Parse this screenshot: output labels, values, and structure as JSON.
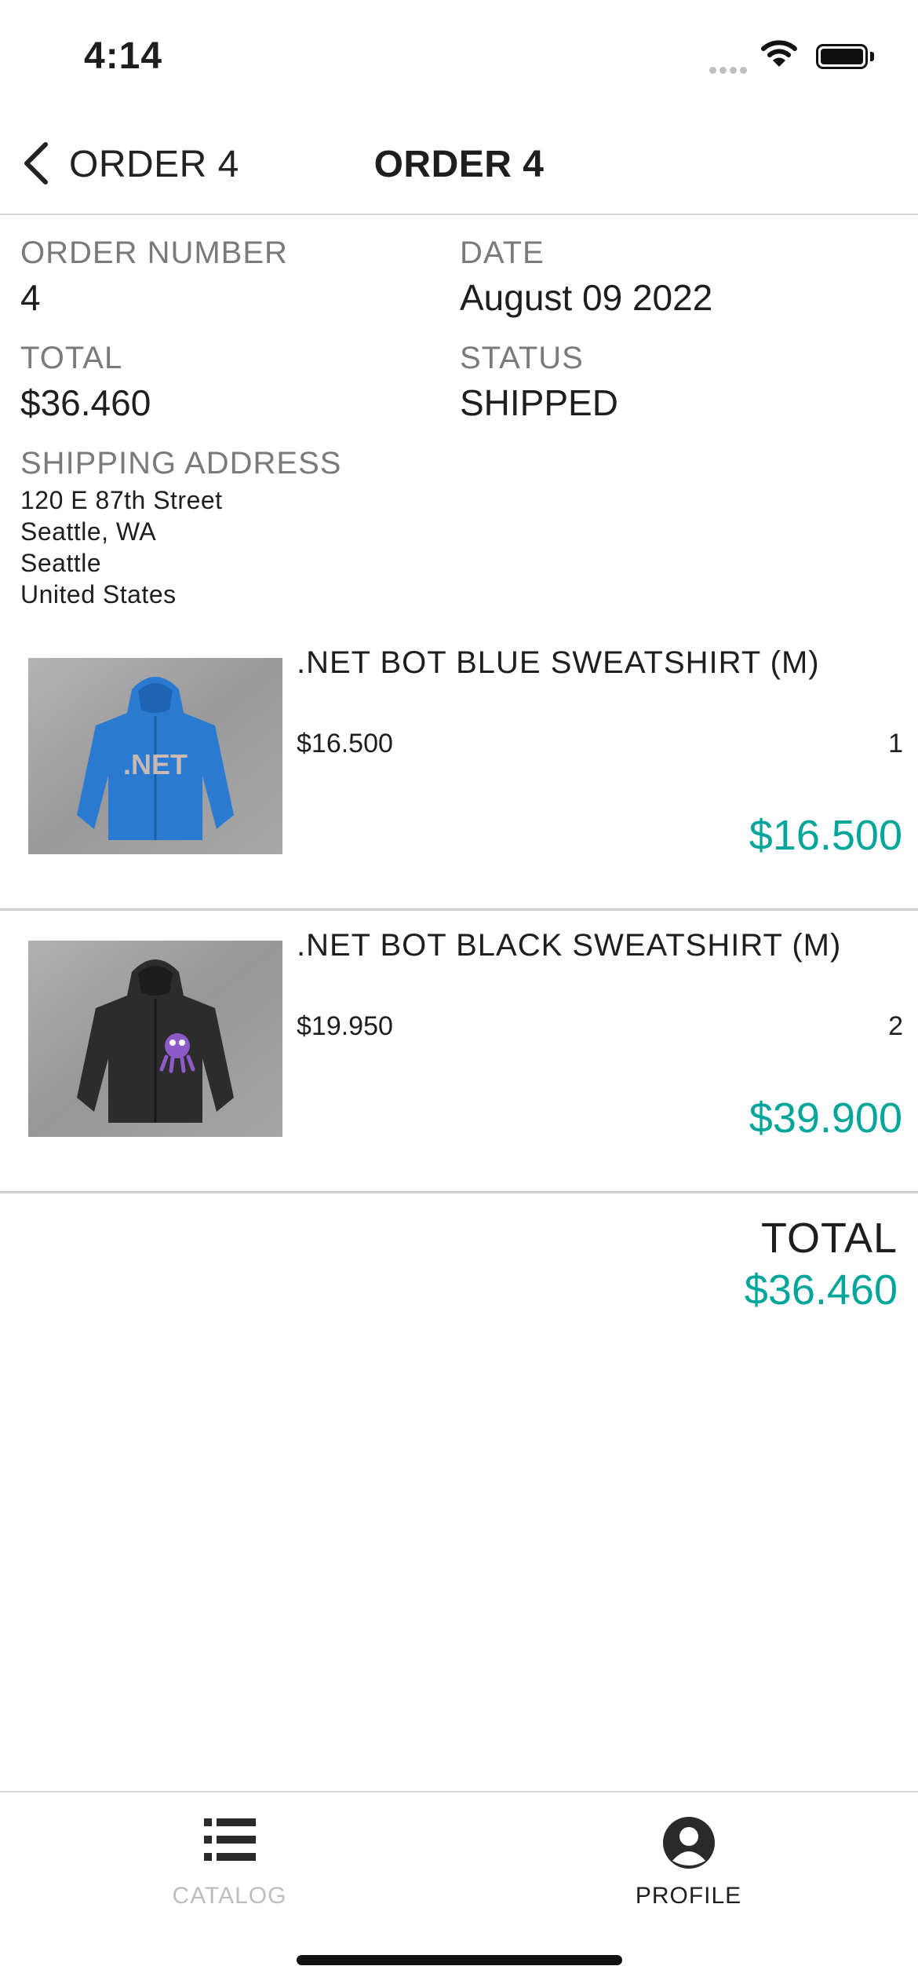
{
  "status_bar": {
    "time": "4:14"
  },
  "nav": {
    "back_label": "ORDER 4",
    "title": "ORDER 4"
  },
  "order": {
    "number_label": "ORDER NUMBER",
    "number": "4",
    "date_label": "DATE",
    "date": "August 09 2022",
    "total_label": "TOTAL",
    "total": "$36.460",
    "status_label": "STATUS",
    "status": "SHIPPED",
    "address_label": "SHIPPING ADDRESS",
    "address_lines": [
      "120 E 87th Street",
      "Seattle, WA",
      "Seattle",
      "United States"
    ]
  },
  "items": [
    {
      "name": ".NET BOT BLUE SWEATSHIRT (M)",
      "unit_price": "$16.500",
      "quantity": "1",
      "total": "$16.500",
      "image_icon": "blue-sweatshirt",
      "image_text": ".NET",
      "color": "#2b7ad1"
    },
    {
      "name": ".NET BOT BLACK SWEATSHIRT (M)",
      "unit_price": "$19.950",
      "quantity": "2",
      "total": "$39.900",
      "image_icon": "black-sweatshirt",
      "color": "#2c2c2c"
    }
  ],
  "summary": {
    "total_label": "TOTAL",
    "total_value": "$36.460"
  },
  "tabs": [
    {
      "label": "CATALOG",
      "icon": "list-icon",
      "active": false
    },
    {
      "label": "PROFILE",
      "icon": "profile-icon",
      "active": true
    }
  ],
  "colors": {
    "accent": "#00a699",
    "muted": "#7a7a7a",
    "inactive_tab": "#bdbdbd"
  }
}
